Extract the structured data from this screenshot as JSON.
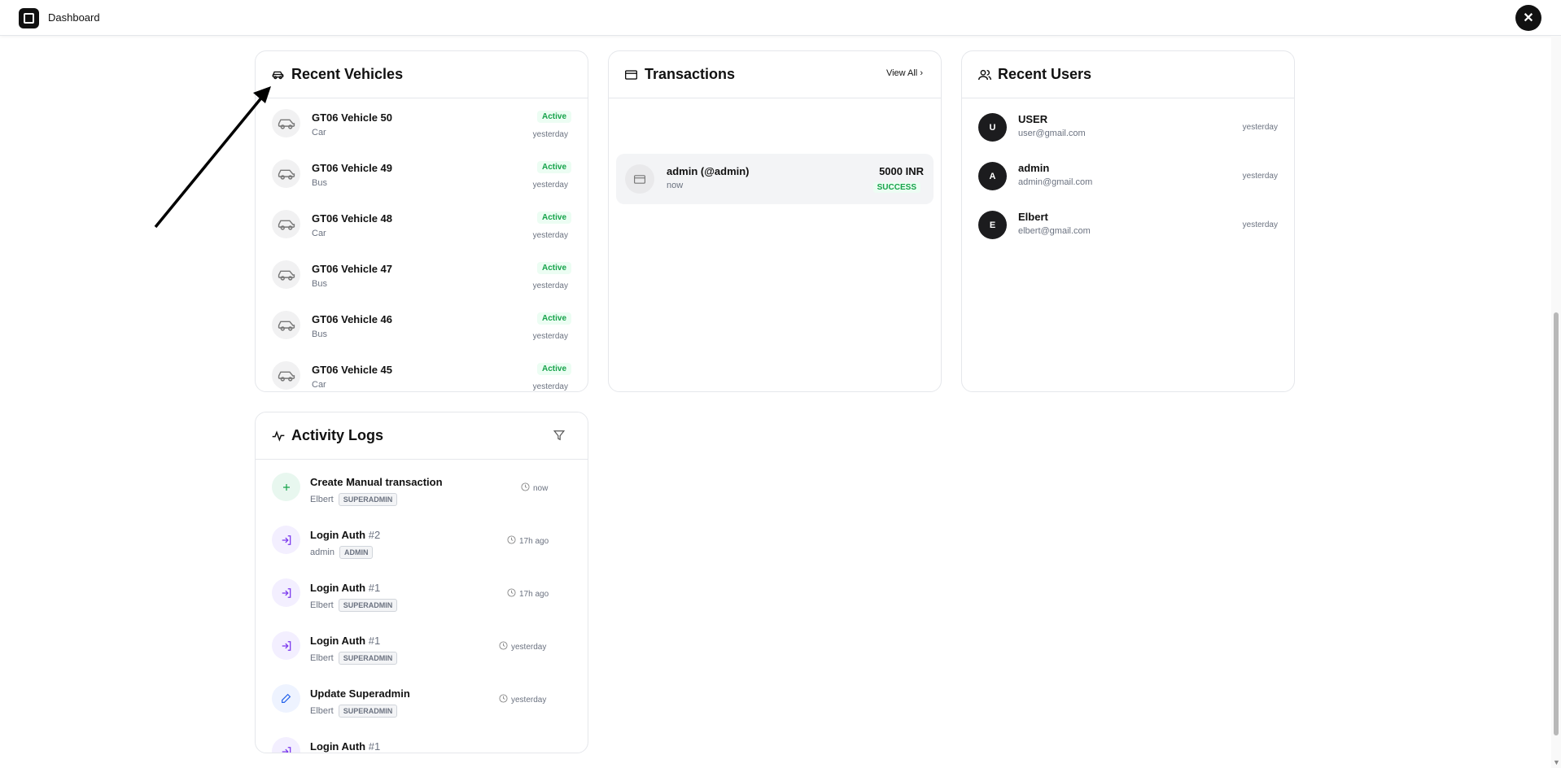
{
  "header": {
    "title": "Dashboard"
  },
  "vehicles": {
    "title": "Recent Vehicles",
    "items": [
      {
        "name": "GT06 Vehicle 50",
        "type": "Car",
        "status": "Active",
        "time": "yesterday"
      },
      {
        "name": "GT06 Vehicle 49",
        "type": "Bus",
        "status": "Active",
        "time": "yesterday"
      },
      {
        "name": "GT06 Vehicle 48",
        "type": "Car",
        "status": "Active",
        "time": "yesterday"
      },
      {
        "name": "GT06 Vehicle 47",
        "type": "Bus",
        "status": "Active",
        "time": "yesterday"
      },
      {
        "name": "GT06 Vehicle 46",
        "type": "Bus",
        "status": "Active",
        "time": "yesterday"
      },
      {
        "name": "GT06 Vehicle 45",
        "type": "Car",
        "status": "Active",
        "time": "yesterday"
      }
    ]
  },
  "transactions": {
    "title": "Transactions",
    "view_all": "View All",
    "items": [
      {
        "user": "admin (@admin)",
        "time": "now",
        "amount": "5000 INR",
        "status": "SUCCESS"
      }
    ]
  },
  "users": {
    "title": "Recent Users",
    "items": [
      {
        "initial": "U",
        "name": "USER",
        "email": "user@gmail.com",
        "time": "yesterday"
      },
      {
        "initial": "A",
        "name": "admin",
        "email": "admin@gmail.com",
        "time": "yesterday"
      },
      {
        "initial": "E",
        "name": "Elbert",
        "email": "elbert@gmail.com",
        "time": "yesterday"
      }
    ]
  },
  "logs": {
    "title": "Activity Logs",
    "items": [
      {
        "action": "Create Manual transaction",
        "num": "",
        "user": "Elbert",
        "role": "SUPERADMIN",
        "time": "now",
        "icon": "plus-icon"
      },
      {
        "action": "Login Auth",
        "num": "#2",
        "user": "admin",
        "role": "ADMIN",
        "time": "17h ago",
        "icon": "login-icon"
      },
      {
        "action": "Login Auth",
        "num": "#1",
        "user": "Elbert",
        "role": "SUPERADMIN",
        "time": "17h ago",
        "icon": "login-icon"
      },
      {
        "action": "Login Auth",
        "num": "#1",
        "user": "Elbert",
        "role": "SUPERADMIN",
        "time": "yesterday",
        "icon": "login-icon"
      },
      {
        "action": "Update Superadmin",
        "num": "",
        "user": "Elbert",
        "role": "SUPERADMIN",
        "time": "yesterday",
        "icon": "pencil-icon"
      },
      {
        "action": "Login Auth",
        "num": "#1",
        "user": "",
        "role": "",
        "time": "",
        "icon": "login-icon"
      }
    ]
  },
  "colors": {
    "accent_green": "#16a34a",
    "login_purple": "#7c3aed",
    "edit_blue": "#2563eb"
  }
}
